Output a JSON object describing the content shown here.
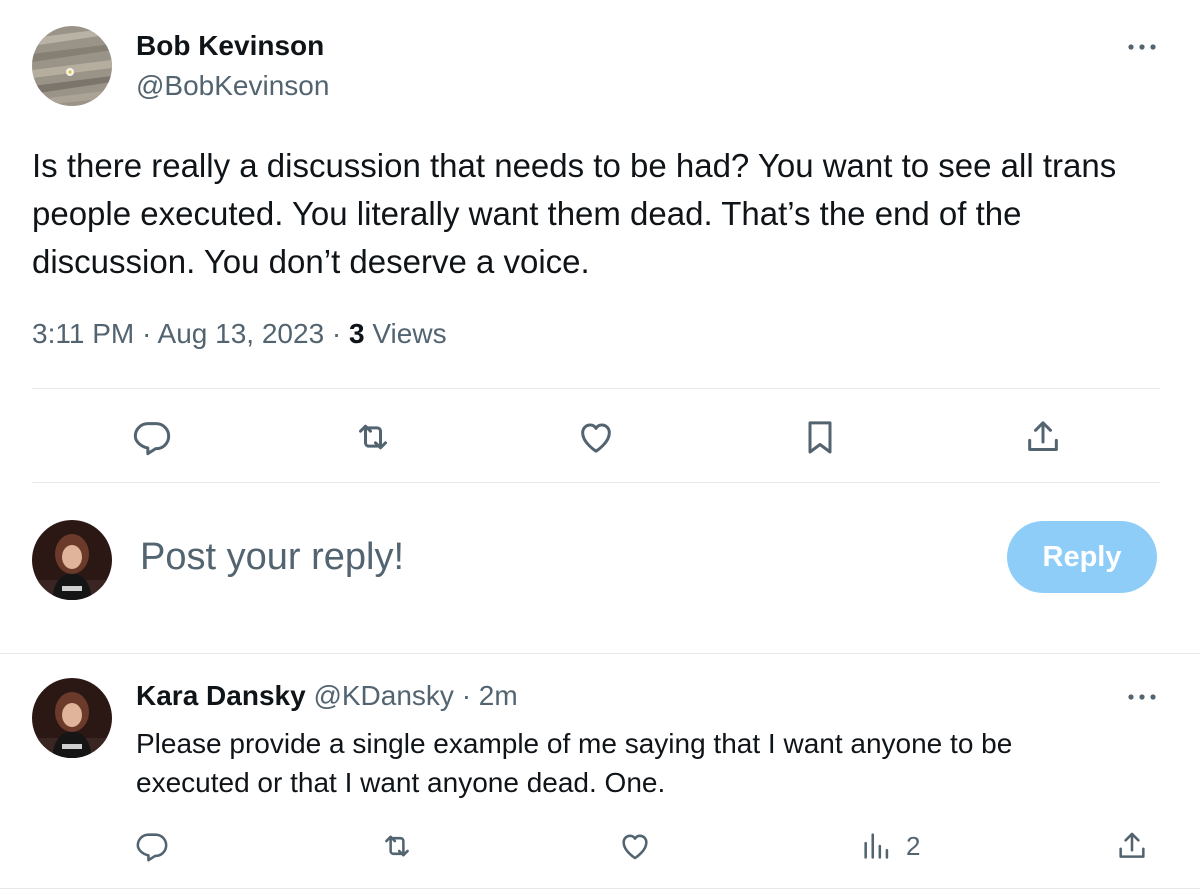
{
  "tweet": {
    "author_name": "Bob Kevinson",
    "author_handle": "@BobKevinson",
    "text": "Is there really a discussion that needs to be had? You want to see all trans people executed. You literally want them dead. That’s the end of the discussion. You don’t deserve a voice.",
    "time": "3:11 PM",
    "separator": "·",
    "date": "Aug 13, 2023",
    "views_count": "3",
    "views_label": "Views",
    "actions": [
      "reply-icon",
      "retweet-icon",
      "like-icon",
      "bookmark-icon",
      "share-icon"
    ]
  },
  "composer": {
    "placeholder": "Post your reply!",
    "button_label": "Reply",
    "button_color": "#8ecdf8"
  },
  "reply": {
    "author_name": "Kara Dansky",
    "author_handle": "@KDansky",
    "separator": "·",
    "time": "2m",
    "text": "Please provide a single example of me saying that I want anyone to be executed or that I want anyone dead. One.",
    "views_count": "2",
    "actions": [
      "reply-icon",
      "retweet-icon",
      "like-icon",
      "views-icon",
      "share-icon"
    ]
  },
  "colors": {
    "text_primary": "#0f1419",
    "text_secondary": "#536471",
    "divider": "#e6e9ec"
  }
}
